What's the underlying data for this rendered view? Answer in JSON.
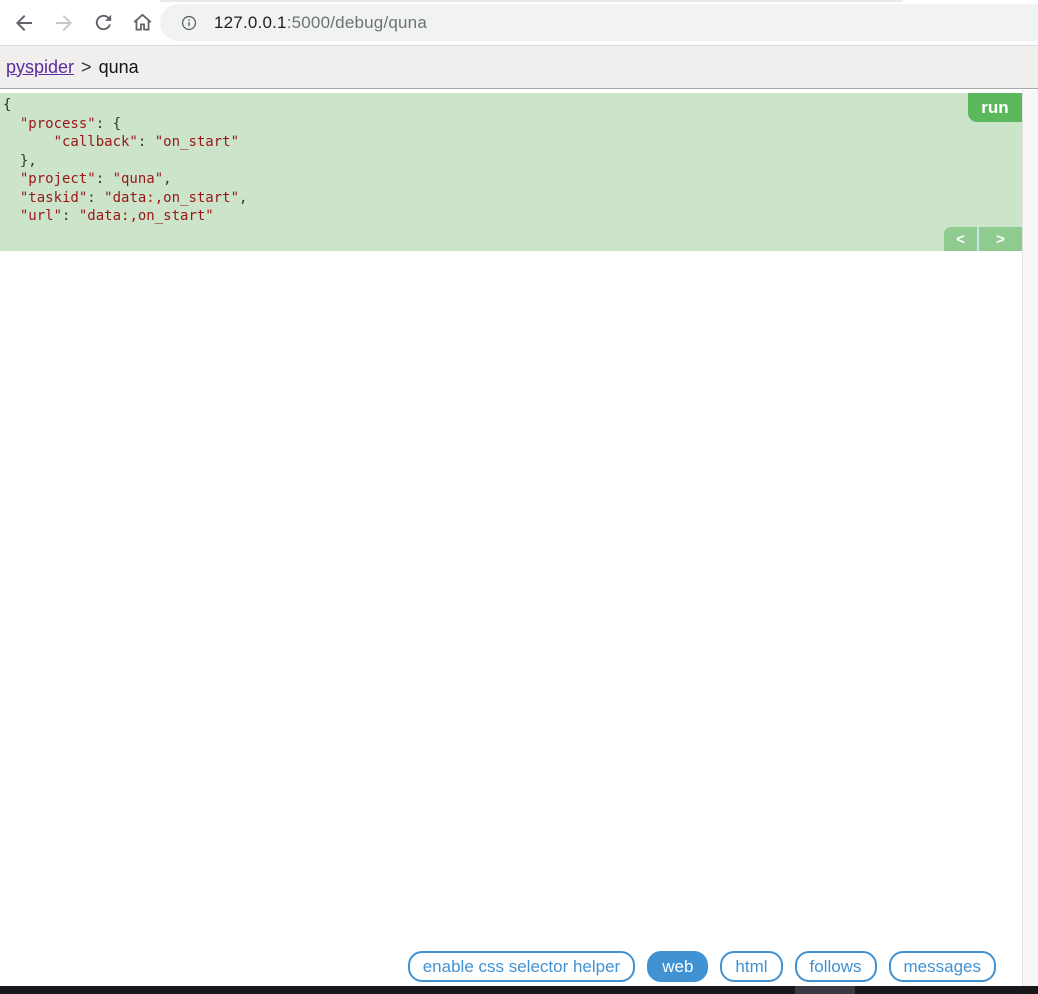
{
  "browser": {
    "url": {
      "host": "127.0.0.1",
      "path": ":5000/debug/quna"
    },
    "icons": {
      "back": "arrow-left",
      "forward": "arrow-right",
      "refresh": "reload-circular-arrow",
      "home": "house-outline",
      "info": "info-circle"
    }
  },
  "breadcrumb": {
    "project_link": "pyspider",
    "separator": ">",
    "current_page": "quna"
  },
  "task_panel": {
    "run_label": "run",
    "prev_label": "<",
    "next_label": ">",
    "code_text": "{\n  \"process\": {\n      \"callback\": \"on_start\"\n  },\n  \"project\": \"quna\",\n  \"taskid\": \"data:,on_start\",\n  \"url\": \"data:,on_start\""
  },
  "footer_toolbar": {
    "buttons": [
      {
        "label": "enable css selector helper",
        "active": false
      },
      {
        "label": "web",
        "active": true
      },
      {
        "label": "html",
        "active": false
      },
      {
        "label": "follows",
        "active": false
      },
      {
        "label": "messages",
        "active": false
      }
    ]
  },
  "colors": {
    "accent_blue": "#4192d3",
    "run_green": "#5cb85c",
    "nav_green": "#8fcb8f",
    "panel_green": "#cbe4ca",
    "code_string_red": "#9b1616",
    "link_purple": "#5a2ca0",
    "dark_bar": "#18171b"
  }
}
